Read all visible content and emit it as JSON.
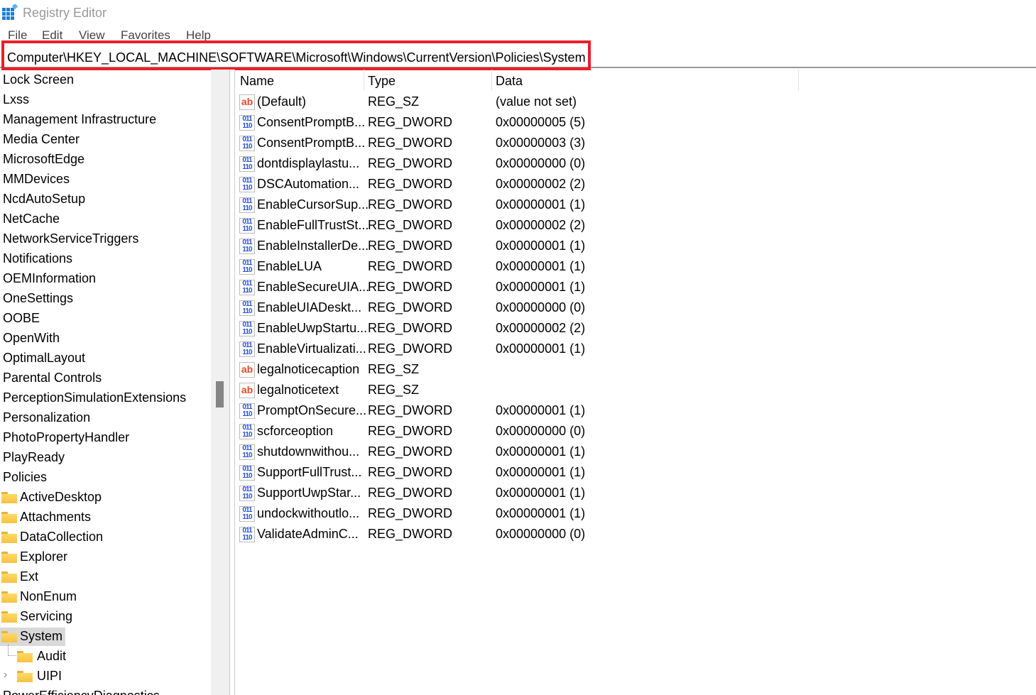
{
  "window": {
    "title": "Registry Editor"
  },
  "menu": [
    "File",
    "Edit",
    "View",
    "Favorites",
    "Help"
  ],
  "address": "Computer\\HKEY_LOCAL_MACHINE\\SOFTWARE\\Microsoft\\Windows\\CurrentVersion\\Policies\\System",
  "tree": [
    {
      "label": "Lock Screen",
      "level": 0,
      "folder": false
    },
    {
      "label": "Lxss",
      "level": 0,
      "folder": false
    },
    {
      "label": "Management Infrastructure",
      "level": 0,
      "folder": false
    },
    {
      "label": "Media Center",
      "level": 0,
      "folder": false
    },
    {
      "label": "MicrosoftEdge",
      "level": 0,
      "folder": false
    },
    {
      "label": "MMDevices",
      "level": 0,
      "folder": false
    },
    {
      "label": "NcdAutoSetup",
      "level": 0,
      "folder": false
    },
    {
      "label": "NetCache",
      "level": 0,
      "folder": false
    },
    {
      "label": "NetworkServiceTriggers",
      "level": 0,
      "folder": false
    },
    {
      "label": "Notifications",
      "level": 0,
      "folder": false
    },
    {
      "label": "OEMInformation",
      "level": 0,
      "folder": false
    },
    {
      "label": "OneSettings",
      "level": 0,
      "folder": false
    },
    {
      "label": "OOBE",
      "level": 0,
      "folder": false
    },
    {
      "label": "OpenWith",
      "level": 0,
      "folder": false
    },
    {
      "label": "OptimalLayout",
      "level": 0,
      "folder": false
    },
    {
      "label": "Parental Controls",
      "level": 0,
      "folder": false
    },
    {
      "label": "PerceptionSimulationExtensions",
      "level": 0,
      "folder": false
    },
    {
      "label": "Personalization",
      "level": 0,
      "folder": false
    },
    {
      "label": "PhotoPropertyHandler",
      "level": 0,
      "folder": false
    },
    {
      "label": "PlayReady",
      "level": 0,
      "folder": false
    },
    {
      "label": "Policies",
      "level": 0,
      "folder": false
    },
    {
      "label": "ActiveDesktop",
      "level": 1,
      "folder": true
    },
    {
      "label": "Attachments",
      "level": 1,
      "folder": true
    },
    {
      "label": "DataCollection",
      "level": 1,
      "folder": true
    },
    {
      "label": "Explorer",
      "level": 1,
      "folder": true
    },
    {
      "label": "Ext",
      "level": 1,
      "folder": true
    },
    {
      "label": "NonEnum",
      "level": 1,
      "folder": true
    },
    {
      "label": "Servicing",
      "level": 1,
      "folder": true
    },
    {
      "label": "System",
      "level": 1,
      "folder": true,
      "selected": true
    },
    {
      "label": "Audit",
      "level": 2,
      "folder": true
    },
    {
      "label": "UIPI",
      "level": 2,
      "folder": true,
      "expandable": true
    },
    {
      "label": "PowerEfficiencyDiagnostics",
      "level": 0,
      "folder": false
    }
  ],
  "columns": {
    "name": "Name",
    "type": "Type",
    "data": "Data"
  },
  "values": [
    {
      "name": "(Default)",
      "type": "REG_SZ",
      "data": "(value not set)",
      "icon": "ab"
    },
    {
      "name": "ConsentPromptB...",
      "type": "REG_DWORD",
      "data": "0x00000005 (5)",
      "icon": "dw"
    },
    {
      "name": "ConsentPromptB...",
      "type": "REG_DWORD",
      "data": "0x00000003 (3)",
      "icon": "dw"
    },
    {
      "name": "dontdisplaylastu...",
      "type": "REG_DWORD",
      "data": "0x00000000 (0)",
      "icon": "dw"
    },
    {
      "name": "DSCAutomation...",
      "type": "REG_DWORD",
      "data": "0x00000002 (2)",
      "icon": "dw"
    },
    {
      "name": "EnableCursorSup...",
      "type": "REG_DWORD",
      "data": "0x00000001 (1)",
      "icon": "dw"
    },
    {
      "name": "EnableFullTrustSt...",
      "type": "REG_DWORD",
      "data": "0x00000002 (2)",
      "icon": "dw"
    },
    {
      "name": "EnableInstallerDe...",
      "type": "REG_DWORD",
      "data": "0x00000001 (1)",
      "icon": "dw"
    },
    {
      "name": "EnableLUA",
      "type": "REG_DWORD",
      "data": "0x00000001 (1)",
      "icon": "dw"
    },
    {
      "name": "EnableSecureUIA...",
      "type": "REG_DWORD",
      "data": "0x00000001 (1)",
      "icon": "dw"
    },
    {
      "name": "EnableUIADeskt...",
      "type": "REG_DWORD",
      "data": "0x00000000 (0)",
      "icon": "dw"
    },
    {
      "name": "EnableUwpStartu...",
      "type": "REG_DWORD",
      "data": "0x00000002 (2)",
      "icon": "dw"
    },
    {
      "name": "EnableVirtualizati...",
      "type": "REG_DWORD",
      "data": "0x00000001 (1)",
      "icon": "dw"
    },
    {
      "name": "legalnoticecaption",
      "type": "REG_SZ",
      "data": "",
      "icon": "ab"
    },
    {
      "name": "legalnoticetext",
      "type": "REG_SZ",
      "data": "",
      "icon": "ab"
    },
    {
      "name": "PromptOnSecure...",
      "type": "REG_DWORD",
      "data": "0x00000001 (1)",
      "icon": "dw"
    },
    {
      "name": "scforceoption",
      "type": "REG_DWORD",
      "data": "0x00000000 (0)",
      "icon": "dw"
    },
    {
      "name": "shutdownwithou...",
      "type": "REG_DWORD",
      "data": "0x00000001 (1)",
      "icon": "dw"
    },
    {
      "name": "SupportFullTrust...",
      "type": "REG_DWORD",
      "data": "0x00000001 (1)",
      "icon": "dw"
    },
    {
      "name": "SupportUwpStar...",
      "type": "REG_DWORD",
      "data": "0x00000001 (1)",
      "icon": "dw"
    },
    {
      "name": "undockwithoutlo...",
      "type": "REG_DWORD",
      "data": "0x00000001 (1)",
      "icon": "dw"
    },
    {
      "name": "ValidateAdminC...",
      "type": "REG_DWORD",
      "data": "0x00000000 (0)",
      "icon": "dw"
    }
  ],
  "icon_text": {
    "ab": "ab",
    "dw": "011\n110"
  },
  "colors": {
    "highlight": "#e8202a",
    "selected": "#d9d9d9"
  }
}
